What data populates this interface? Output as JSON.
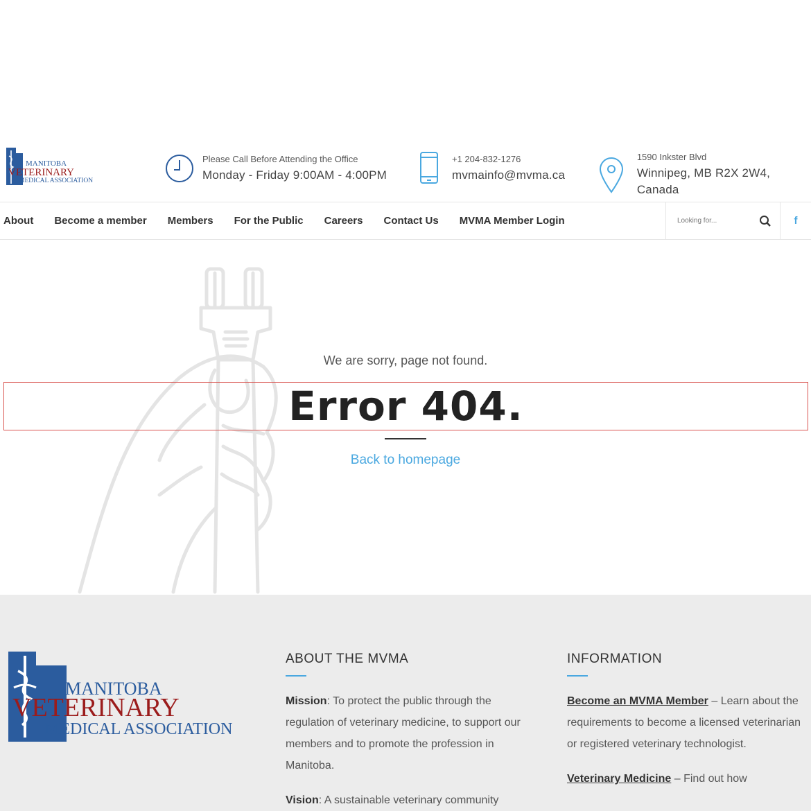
{
  "colors": {
    "accent": "#4aa8e0",
    "logo_blue": "#2b5c9e",
    "logo_red": "#9b1c1c",
    "error_box_border": "#d9534f",
    "footer_bg": "#ececec"
  },
  "logo": {
    "line1": "MANITOBA",
    "line2": "VETERINARY",
    "line3": "MEDICAL ASSOCIATION"
  },
  "header_info": [
    {
      "icon": "clock-icon",
      "small": "Please Call Before Attending the Office",
      "big": "Monday - Friday 9:00AM - 4:00PM"
    },
    {
      "icon": "phone-icon",
      "small": "+1 204-832-1276",
      "big": "mvmainfo@mvma.ca"
    },
    {
      "icon": "location-pin-icon",
      "small": "1590 Inkster Blvd",
      "big": "Winnipeg, MB R2X 2W4, Canada"
    }
  ],
  "nav": {
    "items": [
      "About",
      "Become a member",
      "Members",
      "For the Public",
      "Careers",
      "Contact Us",
      "MVMA Member Login"
    ],
    "search_placeholder": "Looking for...",
    "social_label": "f"
  },
  "error_page": {
    "subtitle": "We are sorry, page not found.",
    "title": "Error 404.",
    "back_link": "Back to homepage"
  },
  "footer": {
    "about": {
      "heading": "ABOUT THE MVMA",
      "mission_label": "Mission",
      "mission_text": ": To protect the public through the regulation of veterinary medicine, to support our members and to promote the profession in Manitoba.",
      "vision_label": "Vision",
      "vision_text": ": A sustainable veterinary community"
    },
    "information": {
      "heading": "INFORMATION",
      "item1_link": "Become an MVMA Member",
      "item1_text": " – Learn about the requirements to become a licensed veterinarian or registered veterinary technologist.",
      "item2_link": "Veterinary Medicine",
      "item2_text": " – Find out how"
    }
  }
}
